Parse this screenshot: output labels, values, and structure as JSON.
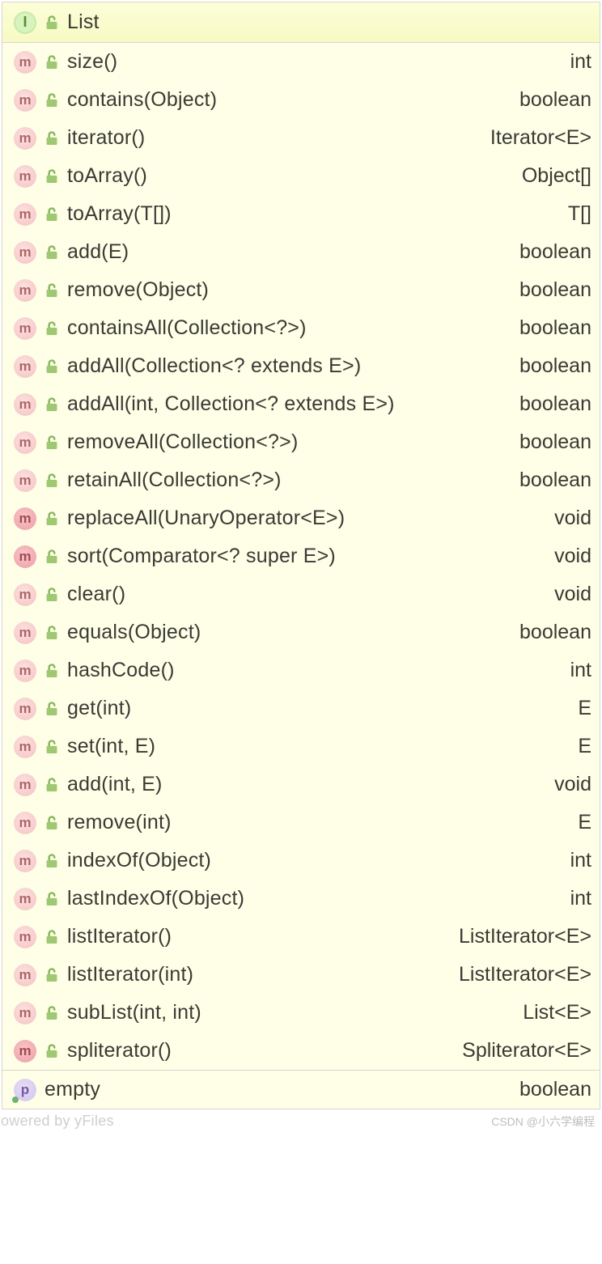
{
  "header": {
    "kind": "I",
    "name": "List"
  },
  "items": [
    {
      "kind": "m",
      "style": "i",
      "name": "size()",
      "type": "int"
    },
    {
      "kind": "m",
      "style": "i",
      "name": "contains(Object)",
      "type": "boolean"
    },
    {
      "kind": "m",
      "style": "i",
      "name": "iterator()",
      "type": "Iterator<E>"
    },
    {
      "kind": "m",
      "style": "i",
      "name": "toArray()",
      "type": "Object[]"
    },
    {
      "kind": "m",
      "style": "i",
      "name": "toArray(T[])",
      "type": "T[]"
    },
    {
      "kind": "m",
      "style": "i",
      "name": "add(E)",
      "type": "boolean"
    },
    {
      "kind": "m",
      "style": "i",
      "name": "remove(Object)",
      "type": "boolean"
    },
    {
      "kind": "m",
      "style": "i",
      "name": "containsAll(Collection<?>)",
      "type": "boolean"
    },
    {
      "kind": "m",
      "style": "i",
      "name": "addAll(Collection<? extends E>)",
      "type": "boolean"
    },
    {
      "kind": "m",
      "style": "i",
      "name": "addAll(int, Collection<? extends E>)",
      "type": "boolean"
    },
    {
      "kind": "m",
      "style": "i",
      "name": "removeAll(Collection<?>)",
      "type": "boolean"
    },
    {
      "kind": "m",
      "style": "i",
      "name": "retainAll(Collection<?>)",
      "type": "boolean"
    },
    {
      "kind": "m",
      "style": "solid",
      "name": "replaceAll(UnaryOperator<E>)",
      "type": "void"
    },
    {
      "kind": "m",
      "style": "solid",
      "name": "sort(Comparator<? super E>)",
      "type": "void"
    },
    {
      "kind": "m",
      "style": "i",
      "name": "clear()",
      "type": "void"
    },
    {
      "kind": "m",
      "style": "i",
      "name": "equals(Object)",
      "type": "boolean"
    },
    {
      "kind": "m",
      "style": "i",
      "name": "hashCode()",
      "type": "int"
    },
    {
      "kind": "m",
      "style": "i",
      "name": "get(int)",
      "type": "E"
    },
    {
      "kind": "m",
      "style": "i",
      "name": "set(int, E)",
      "type": "E"
    },
    {
      "kind": "m",
      "style": "i",
      "name": "add(int, E)",
      "type": "void"
    },
    {
      "kind": "m",
      "style": "i",
      "name": "remove(int)",
      "type": "E"
    },
    {
      "kind": "m",
      "style": "i",
      "name": "indexOf(Object)",
      "type": "int"
    },
    {
      "kind": "m",
      "style": "i",
      "name": "lastIndexOf(Object)",
      "type": "int"
    },
    {
      "kind": "m",
      "style": "i",
      "name": "listIterator()",
      "type": "ListIterator<E>"
    },
    {
      "kind": "m",
      "style": "i",
      "name": "listIterator(int)",
      "type": "ListIterator<E>"
    },
    {
      "kind": "m",
      "style": "i",
      "name": "subList(int, int)",
      "type": "List<E>"
    },
    {
      "kind": "m",
      "style": "solid",
      "name": "spliterator()",
      "type": "Spliterator<E>"
    }
  ],
  "footer": {
    "kind": "p",
    "name": "empty",
    "type": "boolean"
  },
  "watermark": "CSDN @小六学编程",
  "bgfoot": "owered by yFiles"
}
